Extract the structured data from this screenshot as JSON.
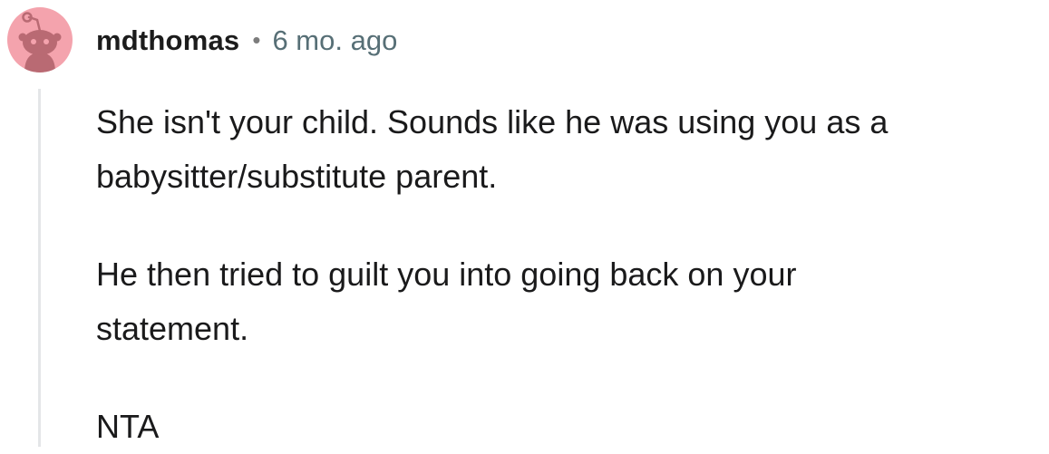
{
  "comment": {
    "author": "mdthomas",
    "separator": "•",
    "timestamp": "6 mo. ago",
    "avatar_icon": "reddit-snoo-avatar-icon",
    "avatar_color": "#f4a3ad",
    "paragraphs": [
      {
        "lines": [
          "She isn't your child. Sounds like he was using you as a",
          "babysitter/substitute parent."
        ]
      },
      {
        "lines": [
          "He then tried to guilt you into going back on your",
          "statement."
        ]
      },
      {
        "lines": [
          "NTA"
        ]
      }
    ]
  }
}
